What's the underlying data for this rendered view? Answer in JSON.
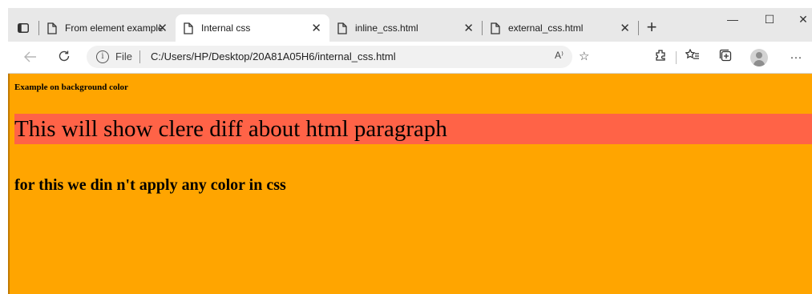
{
  "browser": {
    "tabs": [
      {
        "label": "From element example",
        "active": false
      },
      {
        "label": "Internal css",
        "active": true
      },
      {
        "label": "inline_css.html",
        "active": false
      },
      {
        "label": "external_css.html",
        "active": false
      }
    ],
    "close_glyph": "✕",
    "new_tab_glyph": "+",
    "window_controls": {
      "minimize": "—",
      "maximize": "☐",
      "close": "✕"
    },
    "address": {
      "scheme_label": "File",
      "url": "C:/Users/HP/Desktop/20A81A05H6/internal_css.html",
      "read_aloud": "A⁾"
    },
    "toolbar_icons": [
      "read-aloud-icon",
      "add-favorite-icon",
      "extensions-icon",
      "favorites-icon",
      "collections-icon",
      "profile-icon",
      "more-icon"
    ]
  },
  "page": {
    "background_color": "#ffa500",
    "heading_small": "Example on background color",
    "paragraph": "This will show clere diff about html paragraph",
    "paragraph_bg": "#ff6347",
    "heading_mid": "for this we din n't apply any color in css"
  }
}
